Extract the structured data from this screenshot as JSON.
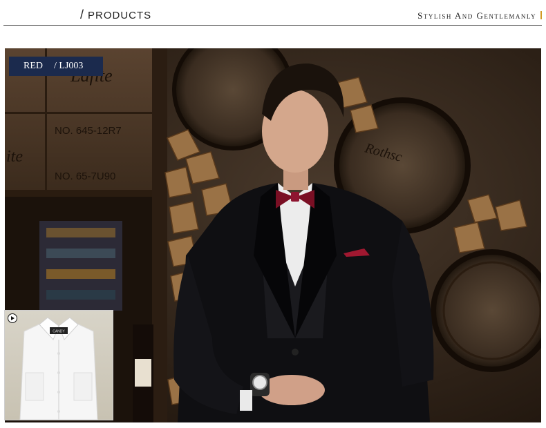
{
  "header": {
    "slash": "/",
    "section_title": "PRODUCTS",
    "tagline": "Stylish And Gentlemanly"
  },
  "hero": {
    "badge_color": "RED",
    "badge_code": "/ LJ003",
    "crate_text": {
      "brand_top": "Lafite",
      "brand_left": "ite",
      "number_1": "NO. 645-12R7",
      "number_2": "NO. 65-7U90",
      "barrel_text": "Rothsc"
    }
  },
  "colors": {
    "badge_bg": "#1b2a4d",
    "tagline_accent": "#d29a24",
    "bowtie": "#7a0f24"
  },
  "thumbnail": {
    "play_icon": "play-circle-icon",
    "shirt_label": "CANDY"
  }
}
